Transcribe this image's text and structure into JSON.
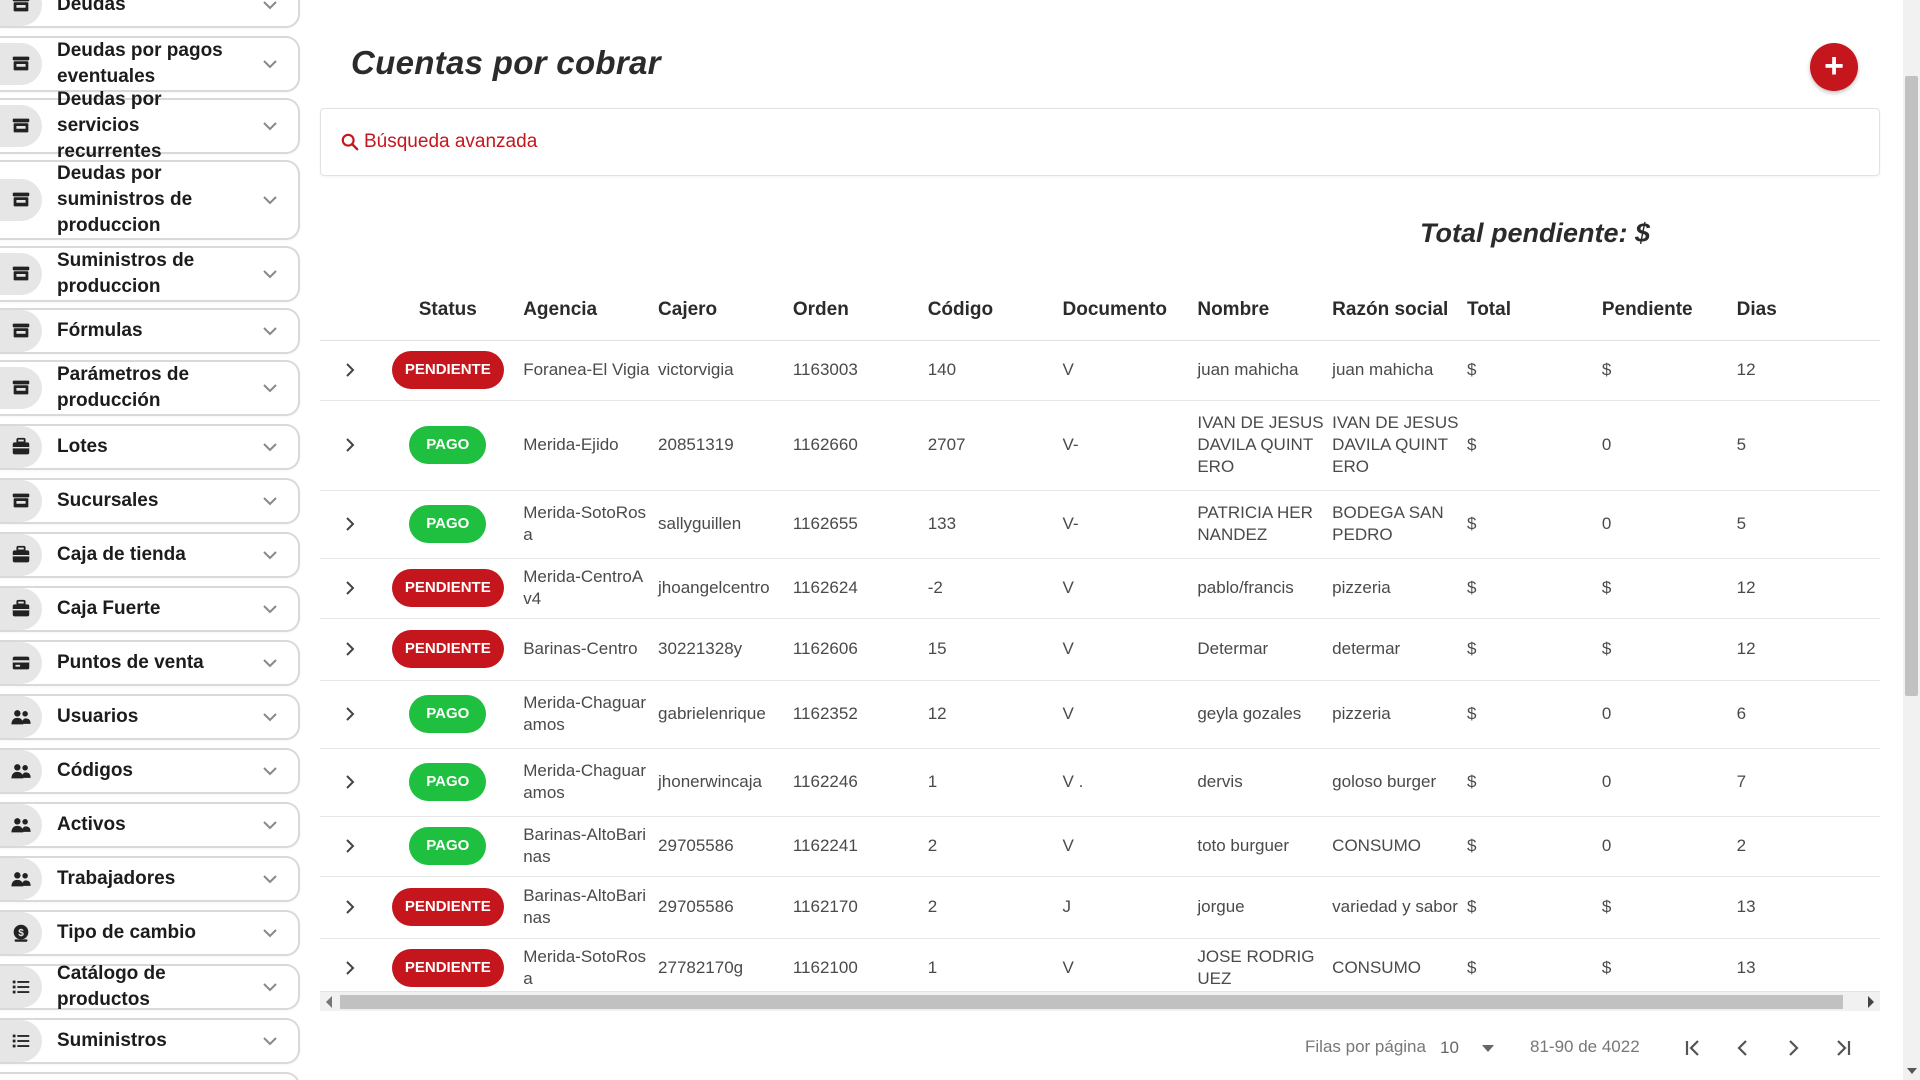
{
  "sidebar": {
    "items": [
      {
        "label": "Deudas",
        "icon": "store-icon"
      },
      {
        "label": "Deudas por pagos eventuales",
        "icon": "store-icon"
      },
      {
        "label": "Deudas por servicios recurrentes",
        "icon": "store-icon"
      },
      {
        "label": "Deudas por suministros de produccion",
        "icon": "store-icon"
      },
      {
        "label": "Suministros de produccion",
        "icon": "store-icon"
      },
      {
        "label": "Fórmulas",
        "icon": "store-icon"
      },
      {
        "label": "Parámetros de producción",
        "icon": "store-icon"
      },
      {
        "label": "Lotes",
        "icon": "briefcase-icon"
      },
      {
        "label": "Sucursales",
        "icon": "store-icon"
      },
      {
        "label": "Caja de tienda",
        "icon": "briefcase-icon"
      },
      {
        "label": "Caja Fuerte",
        "icon": "briefcase-icon"
      },
      {
        "label": "Puntos de venta",
        "icon": "credit-card-icon"
      },
      {
        "label": "Usuarios",
        "icon": "users-icon"
      },
      {
        "label": "Códigos",
        "icon": "users-icon"
      },
      {
        "label": "Activos",
        "icon": "users-icon"
      },
      {
        "label": "Trabajadores",
        "icon": "users-icon"
      },
      {
        "label": "Tipo de cambio",
        "icon": "money-icon"
      },
      {
        "label": "Catálogo de productos",
        "icon": "list-icon"
      },
      {
        "label": "Suministros",
        "icon": "list-icon"
      }
    ]
  },
  "page": {
    "title": "Cuentas por cobrar",
    "search_label": "Búsqueda avanzada",
    "total_pending": "Total pendiente: $"
  },
  "colors": {
    "accent_red": "#c4161c",
    "status_pago": "#1fbf3f",
    "status_pendiente": "#c4161c"
  },
  "table": {
    "headers": [
      "",
      "Status",
      "Agencia",
      "Cajero",
      "Orden",
      "Código",
      "Documento",
      "Nombre",
      "Razón social",
      "Total",
      "Pendiente",
      "Dias",
      ""
    ],
    "rows": [
      {
        "status": "PENDIENTE",
        "agencia": "Foranea-El Vigia",
        "cajero": "victorvigia",
        "orden": "1163003",
        "codigo": "140",
        "documento": "V",
        "nombre": "juan mahicha",
        "razon": "juan mahicha",
        "total": "$",
        "pendiente": "$",
        "dias": "12"
      },
      {
        "status": "PAGO",
        "agencia": "Merida-Ejido",
        "cajero": "20851319",
        "orden": "1162660",
        "codigo": "2707",
        "documento": "V-",
        "nombre": "IVAN DE JESUS DAVILA QUINTERO",
        "razon": "IVAN DE JESUS DAVILA QUINTERO",
        "total": "$",
        "pendiente": "0",
        "dias": "5"
      },
      {
        "status": "PAGO",
        "agencia": "Merida-SotoRosa",
        "cajero": "sallyguillen",
        "orden": "1162655",
        "codigo": "133",
        "documento": "V-",
        "nombre": "PATRICIA HERNANDEZ",
        "razon": "BODEGA SAN PEDRO",
        "total": "$",
        "pendiente": "0",
        "dias": "5"
      },
      {
        "status": "PENDIENTE",
        "agencia": "Merida-CentroAv4",
        "cajero": "jhoangelcentro",
        "orden": "1162624",
        "codigo": "-2",
        "documento": "V",
        "nombre": "pablo/francis",
        "razon": "pizzeria",
        "total": "$",
        "pendiente": "$",
        "dias": "12"
      },
      {
        "status": "PENDIENTE",
        "agencia": "Barinas-Centro",
        "cajero": "30221328y",
        "orden": "1162606",
        "codigo": "15",
        "documento": "V",
        "nombre": "Determar",
        "razon": "determar",
        "total": "$",
        "pendiente": "$",
        "dias": "12"
      },
      {
        "status": "PAGO",
        "agencia": "Merida-Chaguaramos",
        "cajero": "gabrielenrique",
        "orden": "1162352",
        "codigo": "12",
        "documento": "V",
        "nombre": "geyla gozales",
        "razon": "pizzeria",
        "total": "$",
        "pendiente": "0",
        "dias": "6"
      },
      {
        "status": "PAGO",
        "agencia": "Merida-Chaguaramos",
        "cajero": "jhonerwincaja",
        "orden": "1162246",
        "codigo": "1",
        "documento": "V .",
        "nombre": "dervis",
        "razon": "goloso burger",
        "total": "$",
        "pendiente": "0",
        "dias": "7"
      },
      {
        "status": "PAGO",
        "agencia": "Barinas-AltoBarinas",
        "cajero": "29705586",
        "orden": "1162241",
        "codigo": "2",
        "documento": "V",
        "nombre": "toto burguer",
        "razon": "CONSUMO",
        "total": "$",
        "pendiente": "0",
        "dias": "2"
      },
      {
        "status": "PENDIENTE",
        "agencia": "Barinas-AltoBarinas",
        "cajero": "29705586",
        "orden": "1162170",
        "codigo": "2",
        "documento": "J",
        "nombre": "jorgue",
        "razon": "variedad y sabor",
        "total": "$",
        "pendiente": "$",
        "dias": "13"
      },
      {
        "status": "PENDIENTE",
        "agencia": "Merida-SotoRosa",
        "cajero": "27782170g",
        "orden": "1162100",
        "codigo": "1",
        "documento": "V",
        "nombre": "JOSE RODRIGUEZ",
        "razon": "CONSUMO",
        "total": "$",
        "pendiente": "$",
        "dias": "13"
      }
    ]
  },
  "pagination": {
    "rows_per_page_label": "Filas por página",
    "rows_per_page_value": "10",
    "range_text": "81-90 de 4022"
  }
}
